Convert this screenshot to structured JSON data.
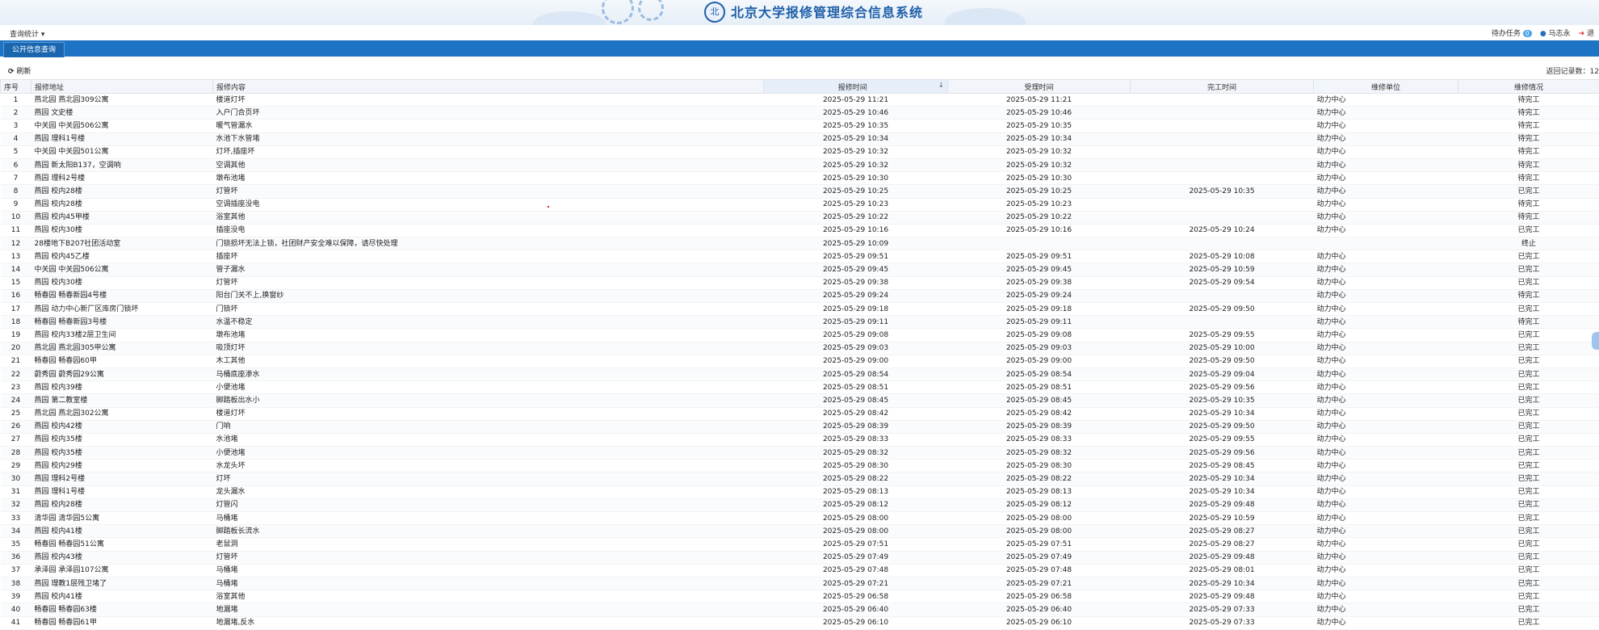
{
  "header": {
    "title": "北京大学报修管理综合信息系统",
    "seal_glyph": "北"
  },
  "menu": {
    "stats_label": "查询统计",
    "stats_arrow": "▾",
    "pending_label": "待办任务",
    "pending_count": "0",
    "user_name": "马志永",
    "exit_label": "退"
  },
  "tabs": [
    {
      "label": "公开信息查询"
    }
  ],
  "toolbar": {
    "refresh_label": "刷新",
    "refresh_icon": "⟳",
    "count_label": "返回记录数：12"
  },
  "table": {
    "columns": [
      "序号",
      "报修地址",
      "报修内容",
      "报修时间",
      "受理时间",
      "完工时间",
      "维修单位",
      "维修情况"
    ],
    "sort_icon": "↓",
    "rows": [
      [
        "1",
        "燕北园 燕北园309公寓",
        "楼道灯坏",
        "2025-05-29 11:21",
        "2025-05-29 11:21",
        "",
        "动力中心",
        "待完工"
      ],
      [
        "2",
        "燕园 文史楼",
        "入户门合页坏",
        "2025-05-29 10:46",
        "2025-05-29 10:46",
        "",
        "动力中心",
        "待完工"
      ],
      [
        "3",
        "中关园 中关园506公寓",
        "暖气管漏水",
        "2025-05-29 10:35",
        "2025-05-29 10:35",
        "",
        "动力中心",
        "待完工"
      ],
      [
        "4",
        "燕园 理科1号楼",
        "水池下水管堵",
        "2025-05-29 10:34",
        "2025-05-29 10:34",
        "",
        "动力中心",
        "待完工"
      ],
      [
        "5",
        "中关园 中关园501公寓",
        "灯坏,插座坏",
        "2025-05-29 10:32",
        "2025-05-29 10:32",
        "",
        "动力中心",
        "待完工"
      ],
      [
        "6",
        "燕园 新太阳B137，空调响",
        "空调其他",
        "2025-05-29 10:32",
        "2025-05-29 10:32",
        "",
        "动力中心",
        "待完工"
      ],
      [
        "7",
        "燕园 理科2号楼",
        "墩布池堵",
        "2025-05-29 10:30",
        "2025-05-29 10:30",
        "",
        "动力中心",
        "待完工"
      ],
      [
        "8",
        "燕园 校内28楼",
        "灯管坏",
        "2025-05-29 10:25",
        "2025-05-29 10:25",
        "2025-05-29 10:35",
        "动力中心",
        "已完工"
      ],
      [
        "9",
        "燕园 校内28楼",
        "空调插座没电",
        "2025-05-29 10:23",
        "2025-05-29 10:23",
        "",
        "动力中心",
        "待完工"
      ],
      [
        "10",
        "燕园 校内45甲楼",
        "浴室其他",
        "2025-05-29 10:22",
        "2025-05-29 10:22",
        "",
        "动力中心",
        "待完工"
      ],
      [
        "11",
        "燕园 校内30楼",
        "插座没电",
        "2025-05-29 10:16",
        "2025-05-29 10:16",
        "2025-05-29 10:24",
        "动力中心",
        "已完工"
      ],
      [
        "12",
        "28楼地下B207社团活动室",
        "门锁损坏无法上锁，社团财产安全难以保障，请尽快处理",
        "2025-05-29 10:09",
        "",
        "",
        "",
        "终止"
      ],
      [
        "13",
        "燕园 校内45乙楼",
        "插座坏",
        "2025-05-29 09:51",
        "2025-05-29 09:51",
        "2025-05-29 10:08",
        "动力中心",
        "已完工"
      ],
      [
        "14",
        "中关园 中关园506公寓",
        "管子漏水",
        "2025-05-29 09:45",
        "2025-05-29 09:45",
        "2025-05-29 10:59",
        "动力中心",
        "已完工"
      ],
      [
        "15",
        "燕园 校内30楼",
        "灯管坏",
        "2025-05-29 09:38",
        "2025-05-29 09:38",
        "2025-05-29 09:54",
        "动力中心",
        "已完工"
      ],
      [
        "16",
        "畅春园 畅春新园4号楼",
        "阳台门关不上,换窗纱",
        "2025-05-29 09:24",
        "2025-05-29 09:24",
        "",
        "动力中心",
        "待完工"
      ],
      [
        "17",
        "燕园 动力中心新厂区库房门锁坏",
        "门锁坏",
        "2025-05-29 09:18",
        "2025-05-29 09:18",
        "2025-05-29 09:50",
        "动力中心",
        "已完工"
      ],
      [
        "18",
        "畅春园 畅春新园3号楼",
        "水温不稳定",
        "2025-05-29 09:11",
        "2025-05-29 09:11",
        "",
        "动力中心",
        "待完工"
      ],
      [
        "19",
        "燕园 校内33楼2层卫生间",
        "墩布池堵",
        "2025-05-29 09:08",
        "2025-05-29 09:08",
        "2025-05-29 09:55",
        "动力中心",
        "已完工"
      ],
      [
        "20",
        "燕北园 燕北园305甲公寓",
        "吸顶灯坏",
        "2025-05-29 09:03",
        "2025-05-29 09:03",
        "2025-05-29 10:00",
        "动力中心",
        "已完工"
      ],
      [
        "21",
        "畅春园 畅春园60甲",
        "木工其他",
        "2025-05-29 09:00",
        "2025-05-29 09:00",
        "2025-05-29 09:50",
        "动力中心",
        "已完工"
      ],
      [
        "22",
        "蔚秀园 蔚秀园29公寓",
        "马桶底座渗水",
        "2025-05-29 08:54",
        "2025-05-29 08:54",
        "2025-05-29 09:04",
        "动力中心",
        "已完工"
      ],
      [
        "23",
        "燕园 校内39楼",
        "小便池堵",
        "2025-05-29 08:51",
        "2025-05-29 08:51",
        "2025-05-29 09:56",
        "动力中心",
        "已完工"
      ],
      [
        "24",
        "燕园 第二教室楼",
        "脚踏板出水小",
        "2025-05-29 08:45",
        "2025-05-29 08:45",
        "2025-05-29 10:35",
        "动力中心",
        "已完工"
      ],
      [
        "25",
        "燕北园 燕北园302公寓",
        "楼道灯坏",
        "2025-05-29 08:42",
        "2025-05-29 08:42",
        "2025-05-29 10:34",
        "动力中心",
        "已完工"
      ],
      [
        "26",
        "燕园 校内42楼",
        "门响",
        "2025-05-29 08:39",
        "2025-05-29 08:39",
        "2025-05-29 09:50",
        "动力中心",
        "已完工"
      ],
      [
        "27",
        "燕园 校内35楼",
        "水池堵",
        "2025-05-29 08:33",
        "2025-05-29 08:33",
        "2025-05-29 09:55",
        "动力中心",
        "已完工"
      ],
      [
        "28",
        "燕园 校内35楼",
        "小便池堵",
        "2025-05-29 08:32",
        "2025-05-29 08:32",
        "2025-05-29 09:56",
        "动力中心",
        "已完工"
      ],
      [
        "29",
        "燕园 校内29楼",
        "水龙头坏",
        "2025-05-29 08:30",
        "2025-05-29 08:30",
        "2025-05-29 08:45",
        "动力中心",
        "已完工"
      ],
      [
        "30",
        "燕园 理科2号楼",
        "灯坏",
        "2025-05-29 08:22",
        "2025-05-29 08:22",
        "2025-05-29 10:34",
        "动力中心",
        "已完工"
      ],
      [
        "31",
        "燕园 理科1号楼",
        "龙头漏水",
        "2025-05-29 08:13",
        "2025-05-29 08:13",
        "2025-05-29 10:34",
        "动力中心",
        "已完工"
      ],
      [
        "32",
        "燕园 校内28楼",
        "灯管闪",
        "2025-05-29 08:12",
        "2025-05-29 08:12",
        "2025-05-29 09:48",
        "动力中心",
        "已完工"
      ],
      [
        "33",
        "清华园 清华园5公寓",
        "马桶堵",
        "2025-05-29 08:00",
        "2025-05-29 08:00",
        "2025-05-29 10:59",
        "动力中心",
        "已完工"
      ],
      [
        "34",
        "燕园 校内41楼",
        "脚踏板长流水",
        "2025-05-29 08:00",
        "2025-05-29 08:00",
        "2025-05-29 08:27",
        "动力中心",
        "已完工"
      ],
      [
        "35",
        "畅春园 畅春园51公寓",
        "老鼠洞",
        "2025-05-29 07:51",
        "2025-05-29 07:51",
        "2025-05-29 08:27",
        "动力中心",
        "已完工"
      ],
      [
        "36",
        "燕园 校内43楼",
        "灯管坏",
        "2025-05-29 07:49",
        "2025-05-29 07:49",
        "2025-05-29 09:48",
        "动力中心",
        "已完工"
      ],
      [
        "37",
        "承泽园 承泽园107公寓",
        "马桶堵",
        "2025-05-29 07:48",
        "2025-05-29 07:48",
        "2025-05-29 08:01",
        "动力中心",
        "已完工"
      ],
      [
        "38",
        "燕园 理教1层残卫堵了",
        "马桶堵",
        "2025-05-29 07:21",
        "2025-05-29 07:21",
        "2025-05-29 10:34",
        "动力中心",
        "已完工"
      ],
      [
        "39",
        "燕园 校内41楼",
        "浴室其他",
        "2025-05-29 06:58",
        "2025-05-29 06:58",
        "2025-05-29 09:48",
        "动力中心",
        "已完工"
      ],
      [
        "40",
        "畅春园 畅春园63楼",
        "地漏堵",
        "2025-05-29 06:40",
        "2025-05-29 06:40",
        "2025-05-29 07:33",
        "动力中心",
        "已完工"
      ],
      [
        "41",
        "畅春园 畅春园61甲",
        "地漏堵,反水",
        "2025-05-29 06:10",
        "2025-05-29 06:10",
        "2025-05-29 07:33",
        "动力中心",
        "已完工"
      ]
    ]
  }
}
